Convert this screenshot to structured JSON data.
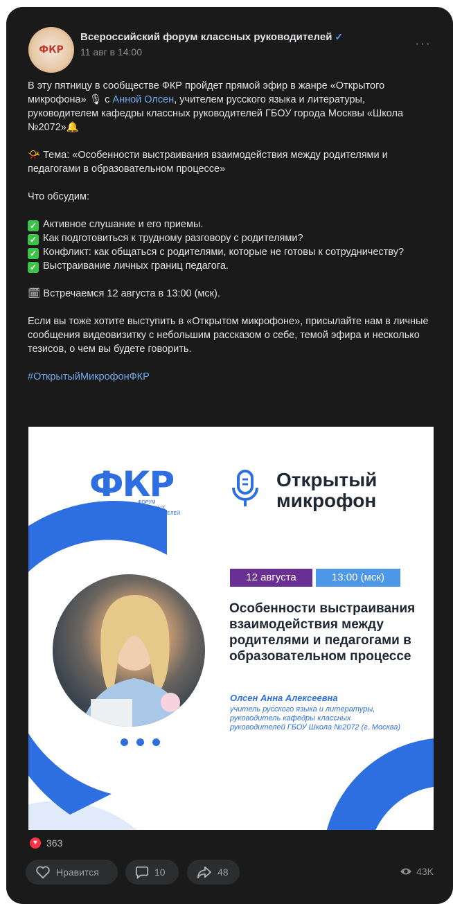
{
  "header": {
    "author": "Всероссийский форум классных руководителей",
    "verified": "✓",
    "date": "11 авг в 14:00",
    "more": "···",
    "avatar_text": "ФКР"
  },
  "post": {
    "p1_a": "В эту пятницу в сообществе ФКР пройдет прямой эфир в жанре «Открытого микрофона» 🎙 с ",
    "p1_link": "Анной Олсен",
    "p1_b": ", учителем русского языка и литературы, руководителем кафедры классных руководителей ГБОУ города Москвы «Школа №2072»🔔",
    "topic": "📯 Тема: «Особенности выстраивания взаимодействия между родителями и педагогами в образовательном процессе»",
    "discuss_title": "Что обсудим:",
    "items": [
      "Активное слушание и его приемы.",
      "Как подготовиться к трудному разговору с родителями?",
      "Конфликт: как общаться с родителями, которые не готовы к сотрудничеству?",
      "Выстраивание личных границ педагога."
    ],
    "meet": "🗓 Встречаемся 12 августа в 13:00 (мск).",
    "invite": "Если вы тоже хотите выступить в «Открытом микрофоне», присылайте нам в личные сообщения видеовизитку с небольшим рассказом о себе, темой эфира и несколько тезисов, о чем вы будете говорить.",
    "hashtag": "#ОткрытыйМикрофонФКР"
  },
  "media": {
    "logo": "ФКР",
    "logo_sub1": "ФОРУМ",
    "logo_sub2": "КЛАССНЫХ",
    "logo_sub3": "РУКОВОДИТЕЛЕЙ",
    "title_line1": "Открытый",
    "title_line2": "микрофон",
    "date_badge": "12 августа",
    "time_badge": "13:00 (мск)",
    "topic": "Особенности выстраивания взаимодействия между родителями и педагогами в образовательном процессе",
    "speaker_name": "Олсен Анна Алексеевна",
    "speaker_desc": "учитель русского языка и литературы, руководитель кафедры классных руководителей ГБОУ Школа №2072 (г. Москва)",
    "accent_blue": "#2d6fe0",
    "accent_purple": "#6a2f92"
  },
  "footer": {
    "likes_count": "363",
    "like_label": "Нравится",
    "comments_count": "10",
    "shares_count": "48",
    "views": "43K"
  }
}
